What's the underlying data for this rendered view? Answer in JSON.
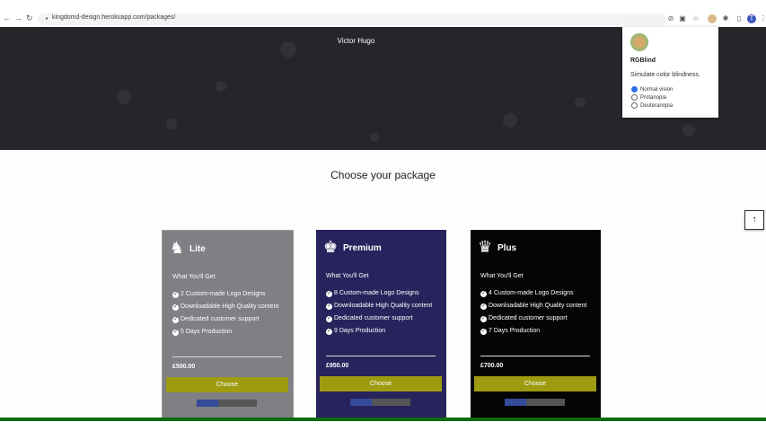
{
  "browser": {
    "url": "kingdomd-design.herokuapp.com/packages/",
    "profile_initial": "T"
  },
  "hero": {
    "author": "Victor Hugo"
  },
  "extension_popup": {
    "title": "RGBlind",
    "subtitle": "Simulate color blindness.",
    "options": [
      "Normal vision",
      "Protanopia",
      "Deuteranopia"
    ],
    "selected": "Normal vision"
  },
  "main": {
    "heading": "Choose your package",
    "scroll_top_icon": "arrow-up-icon"
  },
  "packages": [
    {
      "name": "Lite",
      "icon": "knight-chess-icon",
      "what": "What You'll Get",
      "features": [
        "2 Custom-made Logo Designs",
        "Downloadable High Quality content",
        "Dedicated customer support",
        "5 Days Production"
      ],
      "price": "£500.00",
      "button": "Choose",
      "color": "#7f7f84"
    },
    {
      "name": "Premium",
      "icon": "king-chess-icon",
      "what": "What You'll Get",
      "features": [
        "8 Custom-made Logo Designs",
        "Downloadable High Quality content",
        "Dedicated customer support",
        "9 Days Production"
      ],
      "price": "£950.00",
      "button": "Choose",
      "color": "#27235c"
    },
    {
      "name": "Plus",
      "icon": "queen-chess-icon",
      "what": "What You'll Get",
      "features": [
        "4 Custom-made Logo Designs",
        "Downloadable High Quality content",
        "Dedicated customer support",
        "7 Days Production"
      ],
      "price": "£700.00",
      "button": "Choose",
      "color": "#050505"
    }
  ],
  "colors": {
    "accent_button": "#9e9b10",
    "footer": "#0f6a10"
  }
}
